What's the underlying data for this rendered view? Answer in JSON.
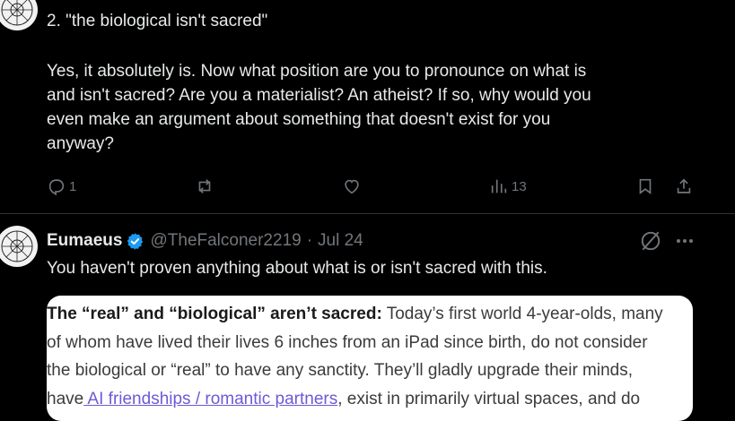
{
  "post1": {
    "line1": "2. \"the biological isn't sacred\"",
    "body": "Yes, it absolutely is. Now what position are you to pronounce on what is\nand isn't sacred? Are you a materialist? An atheist? If so, why would you\neven make an argument about something that doesn't exist for you\nanyway?",
    "reply_count": "1",
    "view_count": "13"
  },
  "post2": {
    "name": "Eumaeus",
    "handle": "@TheFalconer2219",
    "separator": "·",
    "date": "Jul 24",
    "body": "You haven't proven anything about what is or isn't sacred with this."
  },
  "quote": {
    "bold_lead": "The “real” and “biological” aren’t sacred:",
    "text_1": " Today’s first world 4-year-olds, many",
    "line_2": "of whom have lived their lives 6 inches from an iPad since birth, do not consider",
    "line_3": "the biological or “real” to have any sanctity. They’ll gladly upgrade their minds,",
    "line_4_prefix": "have",
    "link_text": " AI friendships / romantic partners",
    "line_4_suffix": ", exist in primarily virtual spaces, and do"
  },
  "colors": {
    "background": "#000000",
    "text": "#e7e9ea",
    "muted": "#71767b",
    "verified": "#1d9bf0",
    "link": "#6b5bd6"
  },
  "icons": [
    "reply-icon",
    "repost-icon",
    "like-icon",
    "views-icon",
    "bookmark-icon",
    "share-icon",
    "verified-icon",
    "grok-icon",
    "more-icon"
  ]
}
